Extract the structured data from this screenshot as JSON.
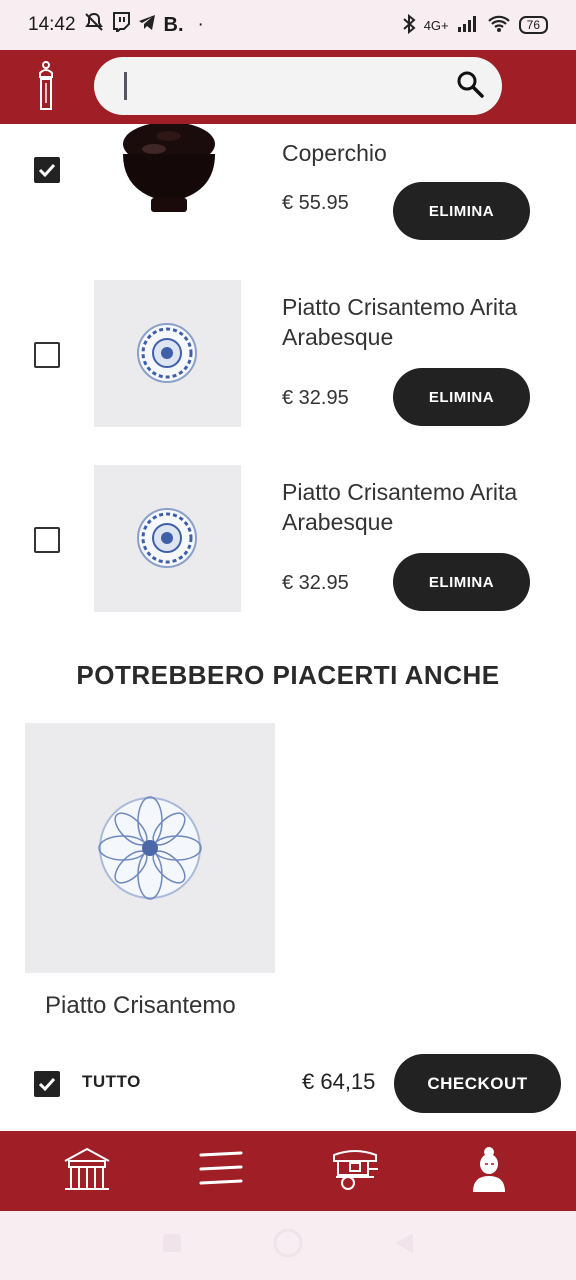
{
  "status": {
    "time": "14:42",
    "app_letter": "B.",
    "dot": "·",
    "network": "4G+",
    "battery": "76"
  },
  "search": {
    "value": "",
    "placeholder": ""
  },
  "cart": {
    "items": [
      {
        "name": "Coperchio",
        "price": "€ 55.95",
        "checked": true,
        "delete_label": "ELIMINA"
      },
      {
        "name": "Piatto Crisantemo Arita Arabesque",
        "price": "€ 32.95",
        "checked": false,
        "delete_label": "ELIMINA"
      },
      {
        "name": "Piatto Crisantemo Arita Arabesque",
        "price": "€ 32.95",
        "checked": false,
        "delete_label": "ELIMINA"
      }
    ]
  },
  "recommendations": {
    "title": "POTREBBERO PIACERTI ANCHE",
    "items": [
      {
        "name": "Piatto Crisantemo"
      }
    ]
  },
  "footer": {
    "select_all_label": "TUTTO",
    "total": "€ 64,15",
    "checkout_label": "CHECKOUT"
  },
  "bottom_nav": {
    "items": [
      {
        "icon": "shop-house-icon"
      },
      {
        "icon": "chopsticks-menu-icon"
      },
      {
        "icon": "food-cart-icon"
      },
      {
        "icon": "geisha-profile-icon"
      }
    ]
  },
  "colors": {
    "brand_red": "#a01f26",
    "button_dark": "#222222"
  }
}
